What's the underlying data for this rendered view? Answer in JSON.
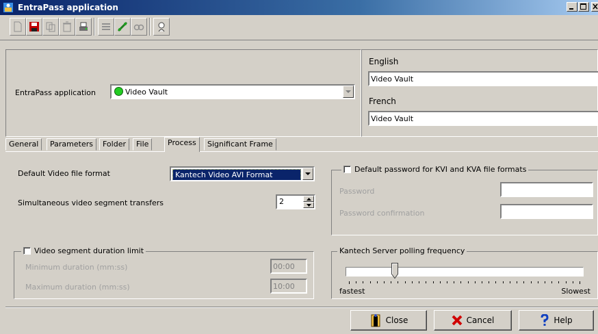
{
  "window": {
    "title": "EntraPass application"
  },
  "toolbar": {
    "icons": [
      "new-icon",
      "save-icon",
      "copy-icon",
      "delete-icon",
      "print-icon",
      "list-icon",
      "link-icon",
      "find-icon",
      "help-icon"
    ]
  },
  "header": {
    "app_label": "EntraPass application",
    "app_value": "Video Vault",
    "english_label": "English",
    "english_value": "Video Vault",
    "french_label": "French",
    "french_value": "Video Vault"
  },
  "tabs": [
    {
      "label": "General"
    },
    {
      "label": "Parameters"
    },
    {
      "label": "Folder"
    },
    {
      "label": "File"
    },
    {
      "label": "Process"
    },
    {
      "label": "Significant Frame"
    }
  ],
  "process": {
    "format_label": "Default Video file format",
    "format_value": "Kantech Video AVI Format",
    "transfers_label": "Simultaneous video segment transfers",
    "transfers_value": "2",
    "duration_group": "Video segment duration limit",
    "min_label": "Minimum duration (mm:ss)",
    "min_value": "00:00",
    "max_label": "Maximum duration (mm:ss)",
    "max_value": "10:00",
    "password_group": "Default password for KVI and KVA file formats",
    "password_label": "Password",
    "password_confirm_label": "Password confirmation",
    "polling_group": "Kantech Server polling frequency",
    "polling_min": "fastest",
    "polling_max": "Slowest",
    "polling_level": 0.2
  },
  "buttons": {
    "close": "Close",
    "cancel": "Cancel",
    "help": "Help"
  },
  "colors": {
    "title_start": "#0a246a",
    "title_end": "#a6caf0",
    "face": "#d4d0c8",
    "selection": "#0a246a",
    "status_green": "#22cc22"
  }
}
